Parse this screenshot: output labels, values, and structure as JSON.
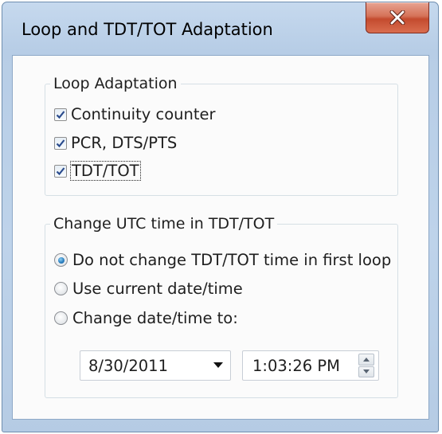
{
  "window": {
    "title": "Loop and TDT/TOT Adaptation",
    "close_icon": "close-icon"
  },
  "loop_adaptation": {
    "legend": "Loop Adaptation",
    "items": [
      {
        "label": "Continuity counter",
        "checked": true
      },
      {
        "label": "PCR, DTS/PTS",
        "checked": true
      },
      {
        "label": "TDT/TOT",
        "checked": true,
        "focused": true
      }
    ]
  },
  "utc_time": {
    "legend": "Change UTC time in TDT/TOT",
    "options": [
      {
        "label": "Do not change TDT/TOT time in first loop",
        "selected": true
      },
      {
        "label": "Use current date/time",
        "selected": false
      },
      {
        "label": "Change date/time to:",
        "selected": false
      }
    ],
    "date_value": "8/30/2011",
    "time_value": "1:03:26 PM"
  },
  "colors": {
    "frame": "#bed3ea",
    "close_button": "#c44b2e",
    "radio_selected": "#2b7fc0",
    "check_mark": "#2a4b8d"
  }
}
